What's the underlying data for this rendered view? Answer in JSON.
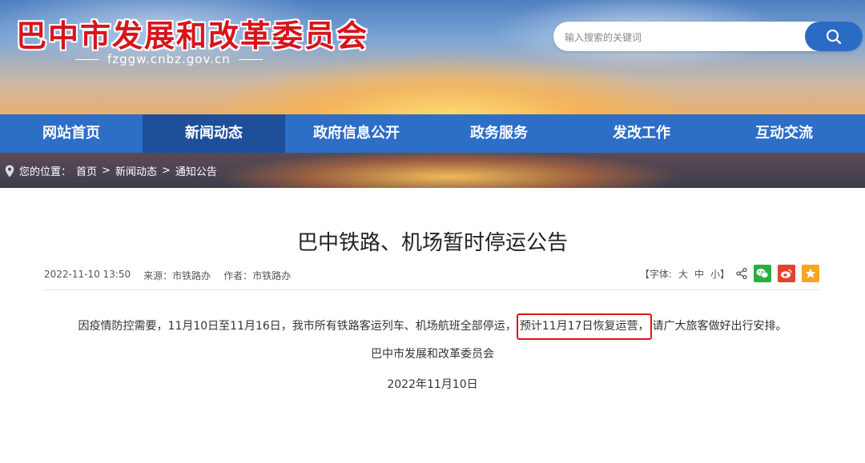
{
  "header": {
    "site_title": "巴中市发展和改革委员会",
    "domain": "fzggw.cnbz.gov.cn",
    "search_placeholder": "输入搜索的关键词"
  },
  "nav": {
    "items": [
      {
        "label": "网站首页"
      },
      {
        "label": "新闻动态",
        "active": true
      },
      {
        "label": "政府信息公开"
      },
      {
        "label": "政务服务"
      },
      {
        "label": "发改工作"
      },
      {
        "label": "互动交流"
      }
    ]
  },
  "breadcrumb": {
    "prefix": "您的位置：",
    "items": [
      "首页",
      "新闻动态",
      "通知公告"
    ],
    "separator": ">"
  },
  "article": {
    "title": "巴中铁路、机场暂时停运公告",
    "datetime": "2022-11-10 13:50",
    "source_label": "来源：",
    "source": "市铁路办",
    "author_label": "作者：",
    "author": "市铁路办",
    "font_label": "【字体:",
    "font_large": "大",
    "font_medium": "中",
    "font_small": "小",
    "font_close": "】",
    "body_before": "因疫情防控需要，11月10日至11月16日，我市所有铁路客运列车、机场航班全部停运，",
    "body_highlight": "预计11月17日恢复运营，",
    "body_after": "请广大旅客做好出行安排。",
    "signature": "巴中市发展和改革委员会",
    "date": "2022年11月10日"
  },
  "colors": {
    "title_red": "#d8141b",
    "nav_blue": "#2d6ec7",
    "nav_active": "#1d4f9a",
    "wechat": "#2aae3f",
    "weibo": "#e0442c",
    "favorite": "#f5a623",
    "highlight_border": "#e0141b"
  },
  "icons": {
    "search": "search-icon",
    "location": "location-pin-icon",
    "share": "share-icon",
    "wechat": "wechat-icon",
    "weibo": "weibo-icon",
    "favorite": "star-icon"
  }
}
